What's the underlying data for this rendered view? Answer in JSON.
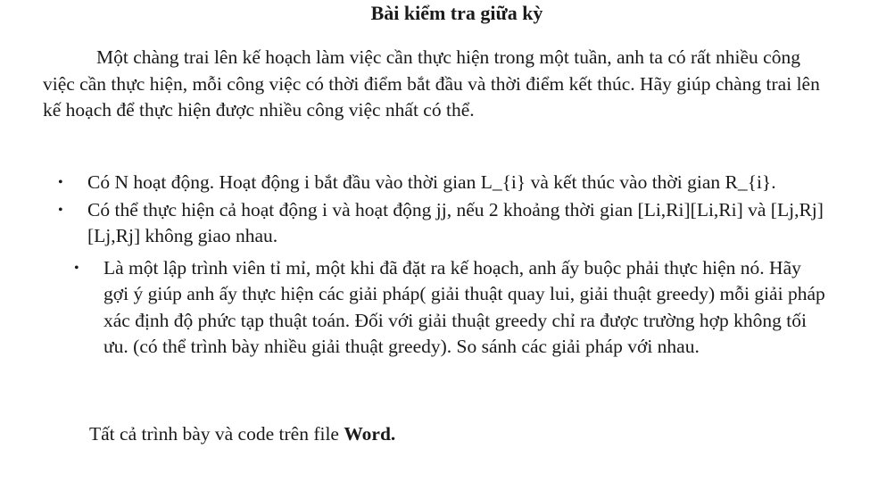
{
  "document": {
    "title": "Bài kiểm tra giữa kỳ",
    "intro": "Một chàng trai lên kế hoạch làm việc cần thực hiện trong một tuần, anh ta có rất nhiều công việc cần thực hiện, mỗi công việc có thời điểm bắt đầu và thời điểm kết thúc. Hãy giúp chàng trai lên kế hoạch để thực hiện được nhiều công việc nhất có thể.",
    "bullet_symbol": "•",
    "bullets": [
      "Có N hoạt động. Hoạt động i bắt đầu vào thời gian L_{i} và kết thúc vào thời gian R_{i}.",
      "Có thể thực hiện cả hoạt động i và hoạt động jj, nếu 2 khoảng thời gian [Li,Ri][Li,Ri] và [Lj,Rj][Lj,Rj] không giao nhau.",
      "Là một lập trình viên tỉ mỉ, một khi đã đặt ra kế hoạch, anh ấy buộc phải thực hiện nó. Hãy gợi ý giúp anh ấy thực hiện các giải pháp( giải thuật quay lui, giải thuật greedy) mỗi giải pháp xác định độ phức tạp thuật toán. Đối với giải thuật greedy chỉ ra được trường hợp không tối ưu. (có thể trình bày nhiều giải thuật greedy). So sánh các giải pháp với nhau."
    ],
    "closing_text": "Tất cả trình bày và code trên file ",
    "closing_bold": "Word."
  }
}
